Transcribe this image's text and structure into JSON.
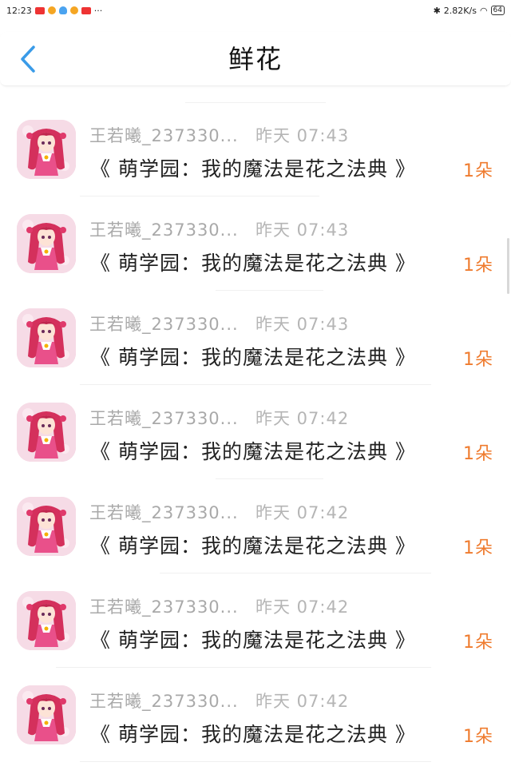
{
  "status_bar": {
    "time": "12:23",
    "more": "···",
    "network_speed": "2.82K/s",
    "battery": "64"
  },
  "header": {
    "title": "鲜花"
  },
  "colors": {
    "accent": "#3a9be8",
    "count_orange": "#ef7b2e",
    "name_gray": "#a9a9a9"
  },
  "items": [
    {
      "name": "王若曦_237330...",
      "time": "昨天 07:43",
      "book": "《 萌学园：我的魔法是花之法典 》",
      "count": "1朵"
    },
    {
      "name": "王若曦_237330...",
      "time": "昨天 07:43",
      "book": "《 萌学园：我的魔法是花之法典 》",
      "count": "1朵"
    },
    {
      "name": "王若曦_237330...",
      "time": "昨天 07:43",
      "book": "《 萌学园：我的魔法是花之法典 》",
      "count": "1朵"
    },
    {
      "name": "王若曦_237330...",
      "time": "昨天 07:42",
      "book": "《 萌学园：我的魔法是花之法典 》",
      "count": "1朵"
    },
    {
      "name": "王若曦_237330...",
      "time": "昨天 07:42",
      "book": "《 萌学园：我的魔法是花之法典 》",
      "count": "1朵"
    },
    {
      "name": "王若曦_237330...",
      "time": "昨天 07:42",
      "book": "《 萌学园：我的魔法是花之法典 》",
      "count": "1朵"
    },
    {
      "name": "王若曦_237330...",
      "time": "昨天 07:42",
      "book": "《 萌学园：我的魔法是花之法典 》",
      "count": "1朵"
    }
  ]
}
